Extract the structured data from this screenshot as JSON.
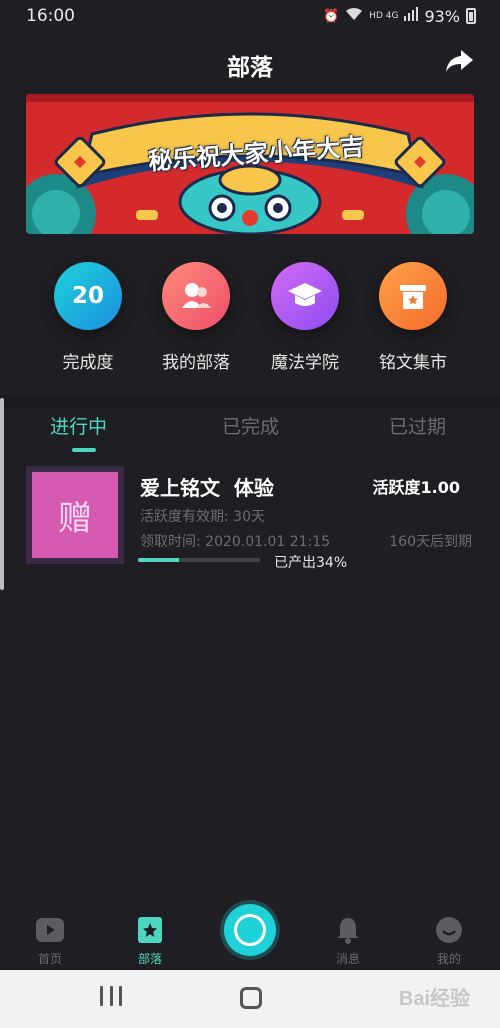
{
  "status_bar": {
    "time": "16:00",
    "network": "HD 4G",
    "battery": "93%"
  },
  "header": {
    "title": "部落"
  },
  "banner": {
    "text": "秘乐祝大家小年大吉"
  },
  "quick_menu": [
    {
      "label": "完成度",
      "value": "20",
      "icon": "score-badge",
      "color": "#18b7e4"
    },
    {
      "label": "我的部落",
      "icon": "people-icon",
      "color": "#f76d6d"
    },
    {
      "label": "魔法学院",
      "icon": "graduation-cap-icon",
      "color": "#b85ef0"
    },
    {
      "label": "铭文集市",
      "icon": "shop-icon",
      "color": "#f7893e"
    }
  ],
  "tabs": [
    {
      "label": "进行中",
      "active": true
    },
    {
      "label": "已完成",
      "active": false
    },
    {
      "label": "已过期",
      "active": false
    }
  ],
  "card": {
    "thumb_text": "赠",
    "title": "爱上铭文  体验",
    "activity": "活跃度1.00",
    "validity": "活跃度有效期: 30天",
    "claim_time": "领取时间: 2020.01.01 21:15",
    "expire": "160天后到期",
    "progress_text": "已产出34%",
    "progress": 0.34
  },
  "bottom_nav": [
    {
      "label": "首页",
      "icon": "play-icon",
      "active": false
    },
    {
      "label": "部落",
      "icon": "tribe-star-icon",
      "active": true
    },
    {
      "label": "消息",
      "icon": "bell-icon",
      "active": false
    },
    {
      "label": "我的",
      "icon": "face-icon",
      "active": false
    }
  ],
  "watermark": "Bai经验",
  "colors": {
    "accent": "#4fd6c0",
    "background": "#1f1f23"
  }
}
